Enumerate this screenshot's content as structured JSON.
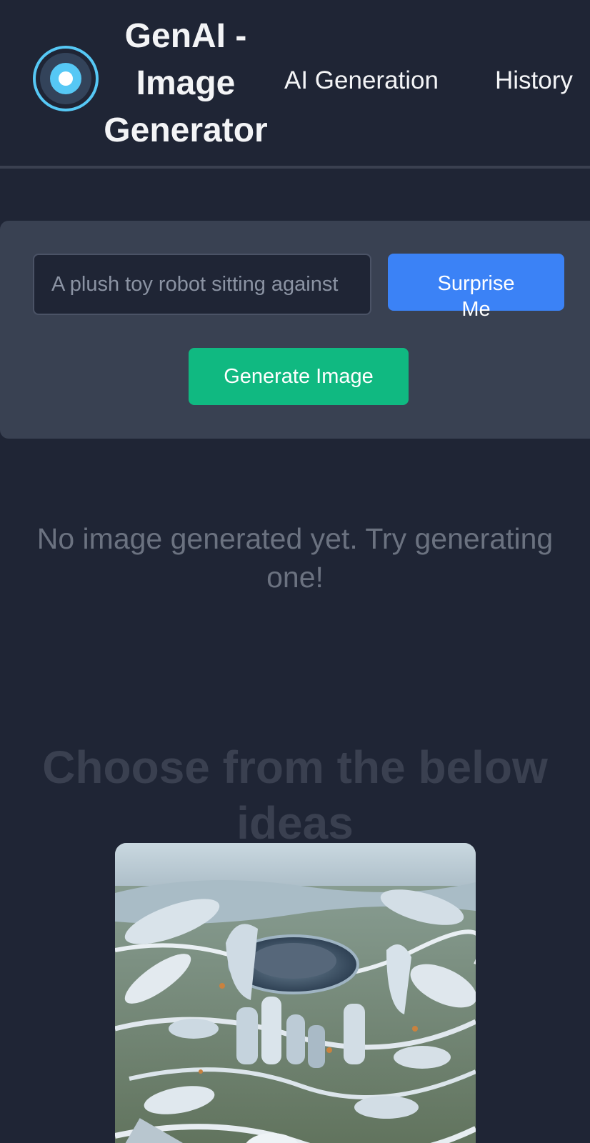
{
  "header": {
    "brand_lines": [
      "GenAI -",
      "Image",
      "Generator"
    ],
    "nav": [
      {
        "label": "AI Generation"
      },
      {
        "label": "History"
      }
    ],
    "logo_icon": "eye-icon"
  },
  "prompt": {
    "placeholder": "A plush toy robot sitting against",
    "value": ""
  },
  "buttons": {
    "surprise_label": "Surprise Me",
    "generate_label": "Generate Image"
  },
  "status": {
    "empty_message": "No image generated yet. Try generating one!"
  },
  "ideas": {
    "heading": "Choose from the below ideas",
    "items": [
      {
        "image": "futuristic-city-aerial"
      }
    ]
  },
  "colors": {
    "background": "#1f2535",
    "card": "#394152",
    "accent_blue": "#3b82f6",
    "accent_green": "#10b981",
    "logo_ring": "#56c8f5"
  }
}
